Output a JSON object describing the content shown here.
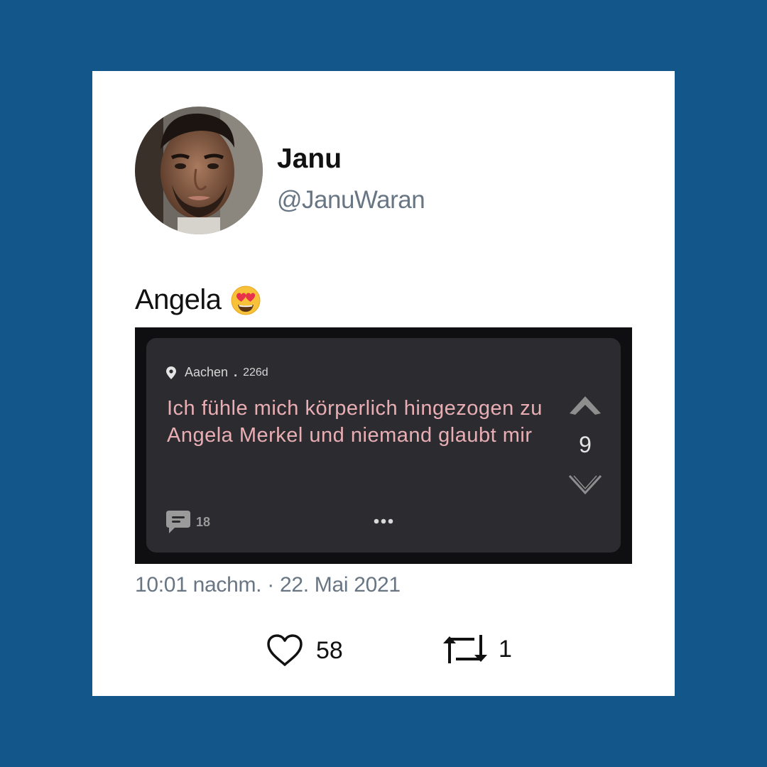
{
  "colors": {
    "frame_background": "#13578a",
    "card_background": "#ffffff",
    "jodel_card": "#2c2c30",
    "jodel_text": "#e9aeb4",
    "secondary_text": "#687684"
  },
  "user": {
    "display_name": "Janu",
    "handle": "@JanuWaran",
    "avatar_icon": "profile-photo"
  },
  "tweet": {
    "text": "Angela",
    "emoji_icon": "smiling-face-with-heart-eyes-emoji",
    "timestamp": "10:01 nachm. · 22. Mai 2021",
    "likes": "58",
    "retweets": "1"
  },
  "jodel": {
    "location": "Aachen",
    "separator": ".",
    "age": "226d",
    "text": "Ich fühle mich körperlich hingezogen zu Angela Merkel und niemand glaubt mir",
    "votes": "9",
    "comments": "18"
  }
}
